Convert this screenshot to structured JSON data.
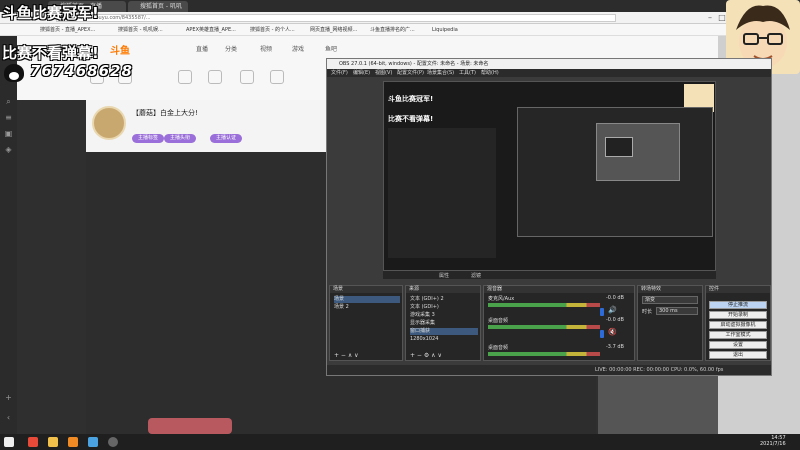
{
  "browser": {
    "tabs": [
      "搜狐首页 - 直播_APEX...",
      "搜狐首页 - 叽叽娱...",
      "APEX英雄直播_APE...",
      "搜狐首页 - 的个人...",
      "网页直播_网络视频...",
      "斗鱼直播排名的广...",
      "Liquipedia"
    ],
    "url": "https://www.douyu.com/8435587/..."
  },
  "overlay": {
    "line1": "斗鱼比赛冠军!",
    "line2": "比赛不看弹幕!",
    "qq_number": "767468628",
    "qq_icon": "qq-penguin-icon"
  },
  "site": {
    "logo": "斗鱼",
    "nav": [
      "直播",
      "分类",
      "视频",
      "游戏",
      "鱼吧"
    ],
    "room_title": "【蘑菇】白金上大分!",
    "pills": [
      "主播标签",
      "主播头衔",
      "主播认证"
    ]
  },
  "obs": {
    "title": "OBS 27.0.1 (64-bit, windows) - 配置文件: 未命名 - 场景: 未命名",
    "menu": [
      "文件(F)",
      "编辑(E)",
      "视图(V)",
      "配置文件(P)",
      "场景集合(S)",
      "工具(T)",
      "帮助(H)"
    ],
    "preview_caption_left": "属性",
    "preview_caption_right": "滤镜",
    "panel_titles": [
      "场景",
      "来源",
      "混音器",
      "转场特效",
      "控件"
    ],
    "scenes": [
      "场景",
      "场景 2"
    ],
    "sources": [
      "文本 (GDI+) 2",
      "文本 (GDI+)",
      "游戏采集 3",
      "显示器采集",
      "窗口捕获",
      "1280x1024"
    ],
    "mixer": [
      {
        "name": "麦克风/Aux",
        "db": "-0.0 dB",
        "level": 0.7
      },
      {
        "name": "桌面音频",
        "db": "-0.0 dB",
        "level": 0.6
      },
      {
        "name": "桌面音频",
        "db": "-3.7 dB",
        "level": 0.55
      }
    ],
    "transition_select": "渐变",
    "transition_duration_label": "时长",
    "transition_duration": "300 ms",
    "controls": [
      "停止推流",
      "开始录制",
      "启动虚拟摄像机",
      "工作室模式",
      "设置",
      "退出"
    ],
    "status": "LIVE: 00:00:00  REC: 00:00:00  CPU: 0.0%, 60.00 fps"
  },
  "taskbar": {
    "time": "14:57",
    "date": "2021/7/16"
  }
}
